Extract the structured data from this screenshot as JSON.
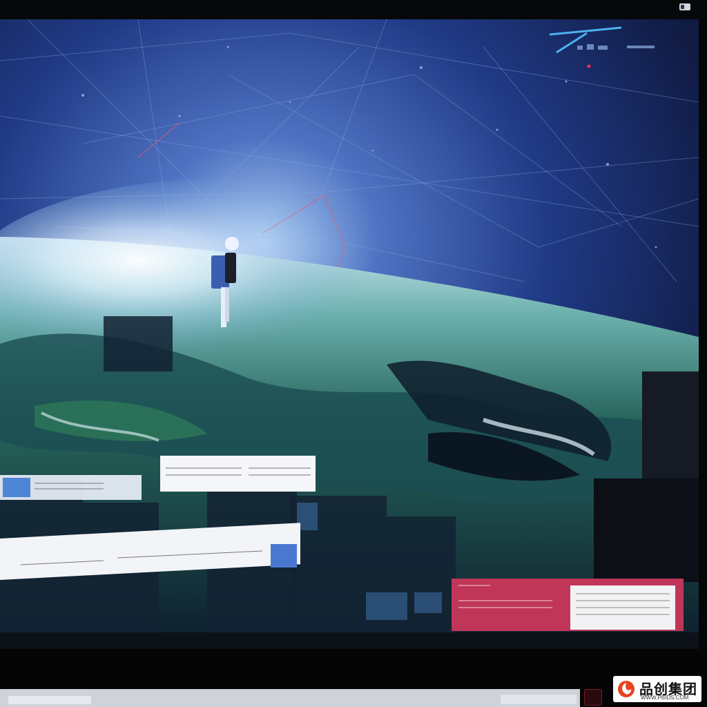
{
  "window": {
    "icon": "window-icon"
  },
  "scene": {
    "description_icon": "astronaut-figure"
  },
  "watermark": {
    "title": "品创集团",
    "subtitle": "WWW.PBIDS.COM",
    "logo_colors": [
      "#e8431f",
      "#c8102e"
    ]
  },
  "colors": {
    "space_deep": "#0a1230",
    "space_mid": "#23408a",
    "glow": "#dff1ff",
    "ocean": "#1e5a4e",
    "panel_pink": "#c03658"
  }
}
